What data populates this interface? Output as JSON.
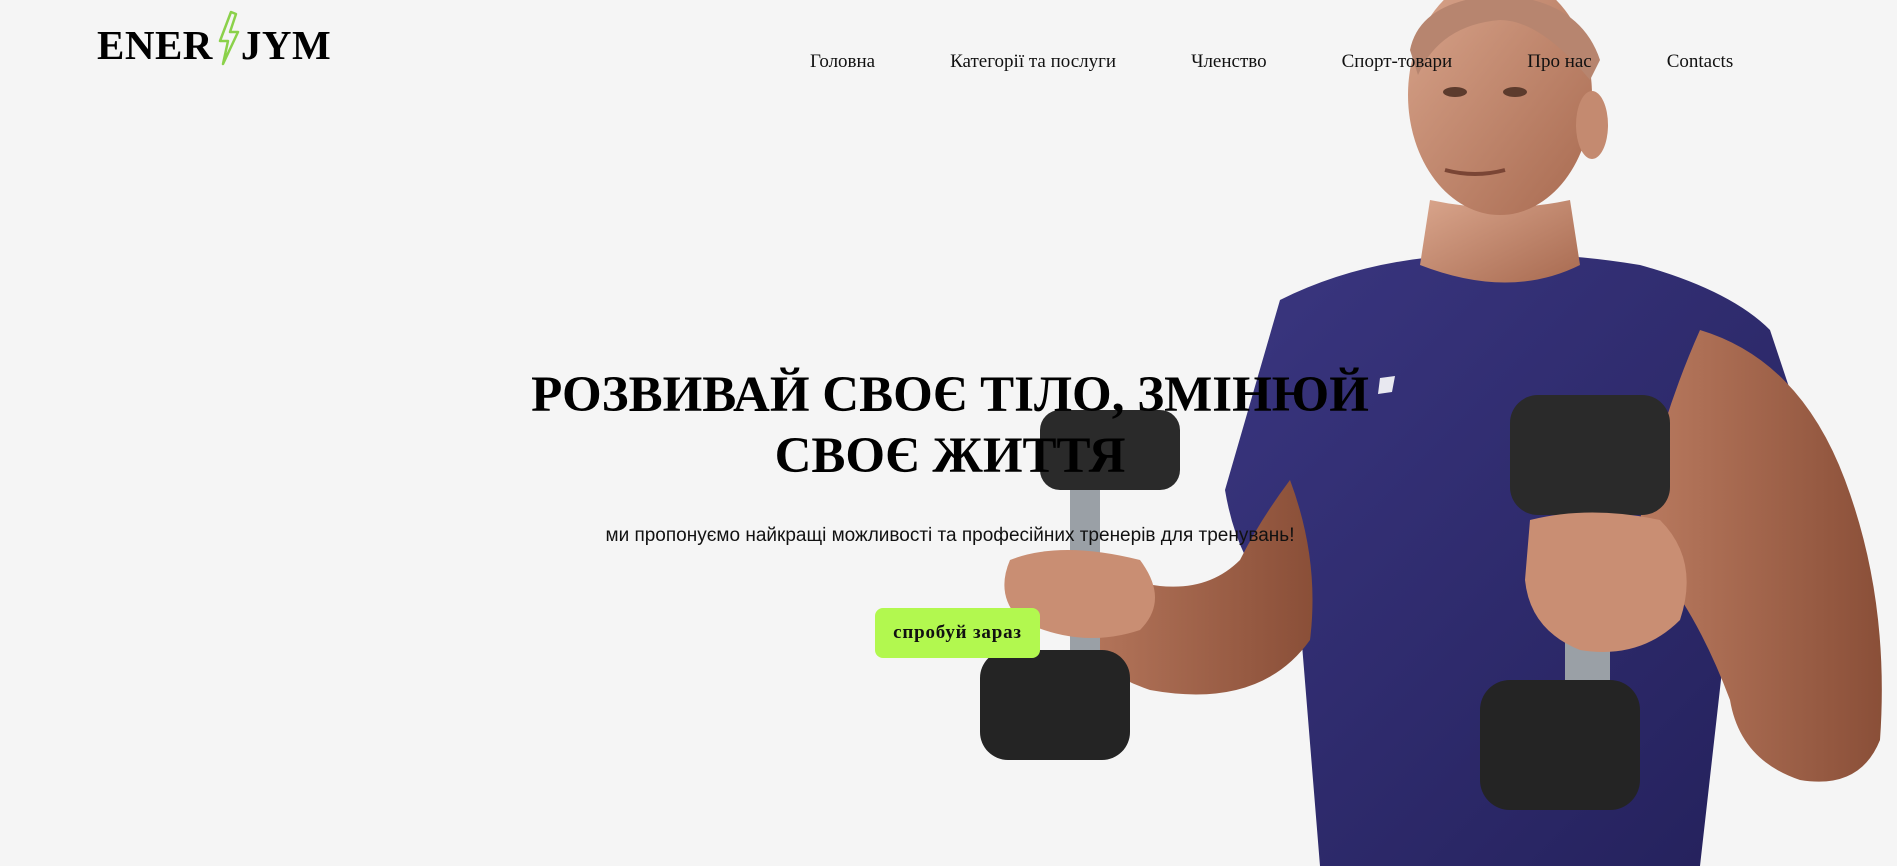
{
  "brand": {
    "name_left": "ENER",
    "name_right": "JYM",
    "bolt_icon": "lightning-bolt-icon",
    "accent_color": "#b2f84f"
  },
  "nav": {
    "items": [
      {
        "label": "Головна"
      },
      {
        "label": "Категорії та послуги"
      },
      {
        "label": "Членство"
      },
      {
        "label": "Спорт-товари"
      },
      {
        "label": "Про нас"
      },
      {
        "label": "Contacts"
      }
    ]
  },
  "hero": {
    "title": "РОЗВИВАЙ СВОЄ ТІЛО, ЗМІНЮЙ СВОЄ ЖИТТЯ",
    "subtitle": "ми пропонуємо найкращі можливості та професійних тренерів для тренувань!",
    "cta_label": "спробуй зараз",
    "image_subject": "athlete-with-dumbbells"
  },
  "colors": {
    "background": "#f5f5f5",
    "text": "#000000",
    "button": "#b2f84f",
    "shirt": "#2d2a6b"
  }
}
